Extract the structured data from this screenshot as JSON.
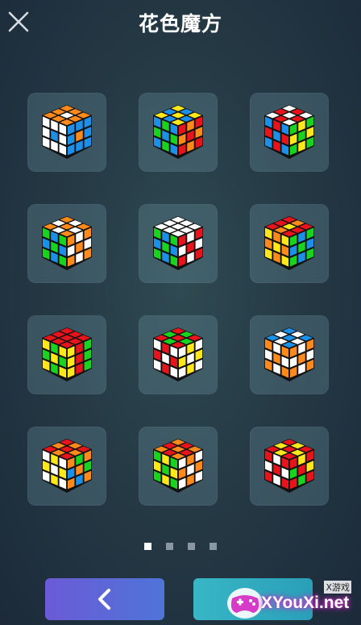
{
  "header": {
    "title": "花色魔方"
  },
  "colors": {
    "W": "#ffffff",
    "Y": "#ffe81a",
    "R": "#e8141c",
    "O": "#ff8a1c",
    "B": "#1c8fe8",
    "G": "#19d41f",
    "K": "#111111"
  },
  "patterns": [
    {
      "name": "pattern-1",
      "top": "OOOOWOOOO",
      "left": "WWWWBWWWW",
      "right": "BBBBOBBBB"
    },
    {
      "name": "pattern-2",
      "top": "YBYBYBYBY",
      "left": "BGBGBGBGB",
      "right": "RORORORO R"
    },
    {
      "name": "pattern-3",
      "top": "WRWRWRWRW",
      "left": "BRBRBRBRB",
      "right": "GYGYGYGYG"
    },
    {
      "name": "pattern-4",
      "top": "OWOWOWOWO",
      "left": "GBGBGBGBG",
      "right": "OWOWOWOWO"
    },
    {
      "name": "pattern-5",
      "top": "WWWWWWWWW",
      "left": "GBGBGBGBG",
      "right": "RWRWRWRWR"
    },
    {
      "name": "pattern-6",
      "top": "RRROYORRR",
      "left": "YOYOYOYOY",
      "right": "GBGBGBGBG"
    },
    {
      "name": "pattern-7",
      "top": "RRRRRRRRR",
      "left": "YGYGYGYGY",
      "right": "YRGYRGYRG"
    },
    {
      "name": "pattern-8",
      "top": "RGRGRGRGR",
      "left": "WRWRWRWRW",
      "right": "WYWYWYWYW"
    },
    {
      "name": "pattern-9",
      "top": "BWBWBWBWB",
      "left": "OWOWOWOWO",
      "right": "OWOWOWOWO"
    },
    {
      "name": "pattern-10",
      "top": "ROROROROR",
      "left": "WYWYWYWYW",
      "right": "OGOBOGOBO"
    },
    {
      "name": "pattern-11",
      "top": "ORORORORO",
      "left": "GYGYGYGYG",
      "right": "WOWOWOWOW"
    },
    {
      "name": "pattern-12",
      "top": "RYRYRYRYR",
      "left": "RWRWRWRWR",
      "right": "RYRGRYRGR"
    }
  ],
  "pagination": {
    "count": 4,
    "active": 1
  },
  "buttons": {
    "back_icon": "chevron-left-icon"
  },
  "watermark": {
    "small": "X游戏",
    "big": "XYouXi.net"
  }
}
